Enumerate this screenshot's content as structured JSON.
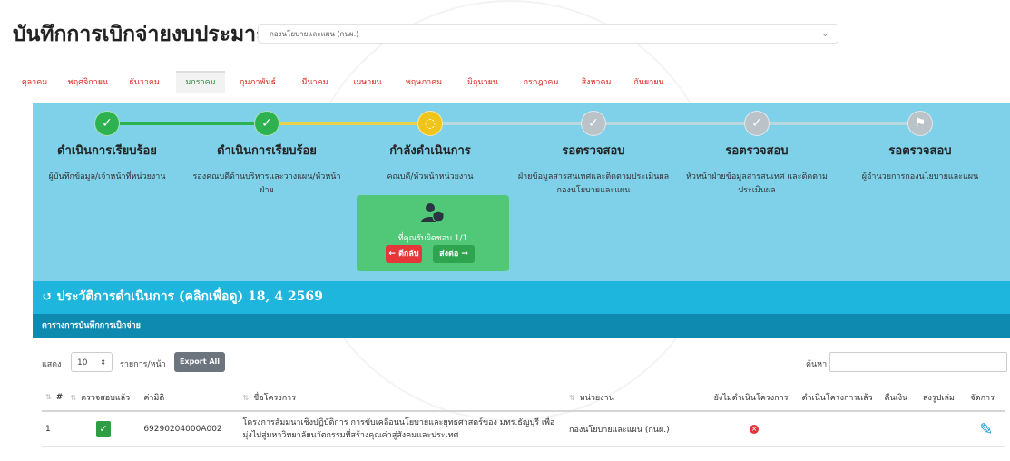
{
  "header": {
    "title": "บันทึกการเบิกจ่ายงบประมาณ",
    "department_select": "กองนโยบายและแผน (กนผ.)"
  },
  "months": [
    "ตุลาคม",
    "พฤศจิกายน",
    "ธันวาคม",
    "มกราคม",
    "กุมภาพันธ์",
    "มีนาคม",
    "เมษายน",
    "พฤษภาคม",
    "มิถุนายน",
    "กรกฎาคม",
    "สิงหาคม",
    "กันยายน"
  ],
  "active_month": "มกราคม",
  "workflow": {
    "steps": [
      {
        "status": "ดำเนินการเรียบร้อย",
        "desc": "ผู้บันทึกข้อมูล/เจ้าหน้าที่หน่วยงาน",
        "state": "done"
      },
      {
        "status": "ดำเนินการเรียบร้อย",
        "desc": "รองคณบดีด้านบริหารและวางแผน/หัวหน้าฝ่าย",
        "state": "done"
      },
      {
        "status": "กำลังดำเนินการ",
        "desc": "คณบดี/หัวหน้าหน่วยงาน",
        "state": "current"
      },
      {
        "status": "รอตรวจสอบ",
        "desc": "ฝ่ายข้อมูลสารสนเทศและติดตามประเมินผล กองนโยบายและแผน",
        "state": "pending"
      },
      {
        "status": "รอตรวจสอบ",
        "desc": "หัวหน้าฝ่ายข้อมูลสารสนเทศ และติดตามประเมินผล",
        "state": "pending"
      },
      {
        "status": "รอตรวจสอบ",
        "desc": "ผู้อำนวยการกองนโยบายและแผน",
        "state": "final"
      }
    ],
    "responsible_text": "ที่คุณรับผิดชอบ 1/1",
    "back_label": "← ตีกลับ",
    "next_label": "ส่งต่อ →"
  },
  "history_label": "ประวัติการดำเนินการ (คลิกเพื่อดู) 18, 4 2569",
  "table_title": "ตารางการบันทึกการเบิกจ่าย",
  "controls": {
    "show_label": "แสดง",
    "page_size": "10",
    "per_page_label": "รายการ/หน้า",
    "export_label": "Export All",
    "search_label": "ค้นหา :"
  },
  "table": {
    "headers": [
      "#",
      "ตรวจสอบแล้ว",
      "ค่ามิติ",
      "ชื่อโครงการ",
      "หน่วยงาน",
      "ยังไม่ดำเนินโครงการ",
      "ดำเนินโครงการแล้ว",
      "คืนเงิน",
      "ส่งรูปเล่ม",
      "จัดการ"
    ],
    "rows": [
      {
        "no": "1",
        "code": "69290204000A002",
        "project": "โครงการสัมมนาเชิงปฏิบัติการ การขับเคลื่อนนโยบายและยุทธศาสตร์ของ มทร.ธัญบุรี เพื่อมุ่งไปสู่มหาวิทยาลัยนวัตกรรมที่สร้างคุณค่าสู่สังคมและประเทศ",
        "unit": "กองนโยบายและแผน (กนผ.)"
      }
    ]
  },
  "colors": {
    "workflow_bg": "#7fd0e9",
    "done": "#2eb24f",
    "current": "#f0c419",
    "pending": "#b9c3c8",
    "history_bar": "#1fb6de",
    "table_title_bar": "#0e8ab0",
    "month_link": "#d9261c",
    "active_month": "#2f8a3c"
  }
}
